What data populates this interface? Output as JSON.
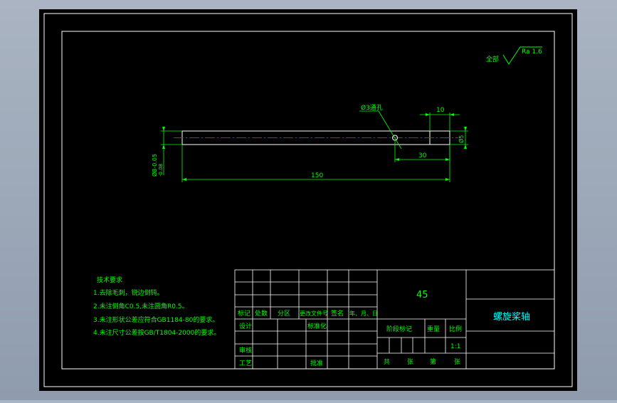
{
  "colors": {
    "background": "#000000",
    "frame": "#ffffff",
    "text": "#00ff00",
    "text_title": "#00ffff",
    "centerline": "#ff0000",
    "chrome": "#a0abbb"
  },
  "surface_finish": {
    "prefix": "全部",
    "value": "Ra 1.6"
  },
  "dimensions": {
    "hole_note": "Ø3通孔",
    "top_len": "10",
    "pos_len": "30",
    "total_len": "150",
    "right_dia": "Ø5",
    "left_dia": "Ø8-0.05",
    "left_dia_tol": "-0.08"
  },
  "tech_req": {
    "title": "技术要求",
    "items": [
      "1.去除毛刺，锐边倒钝。",
      "2.未注倒角C0.5,未注圆角R0.5。",
      "3.未注形状公差应符合GB1184-80的要求。",
      "4.未注尺寸公差按GB/T1804-2000的要求。"
    ]
  },
  "title_block": {
    "material": "45",
    "part_name": "螺旋桨轴",
    "rev_headers": [
      "标记",
      "处数",
      "分区",
      "更改文件号",
      "签名",
      "年、月、日"
    ],
    "design": "设计",
    "standardize": "标准化",
    "review": "审核",
    "process": "工艺",
    "approve": "批准",
    "stage_mark": "阶段标记",
    "weight": "重量",
    "scale_label": "比例",
    "scale_value": "1:1",
    "total": "共",
    "sheets": "张",
    "number": "第",
    "sheet": "张"
  }
}
